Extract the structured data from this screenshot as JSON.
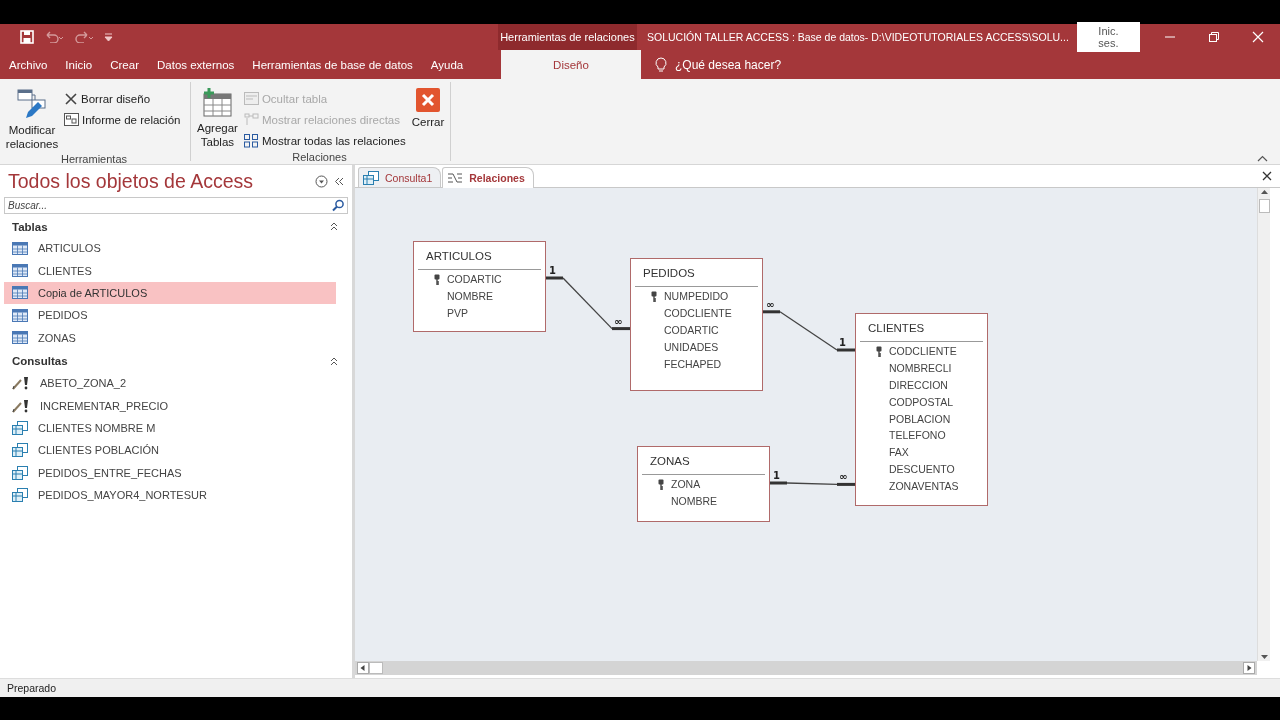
{
  "window": {
    "context_tab": "Herramientas de relaciones",
    "title": "SOLUCIÓN TALLER ACCESS : Base de datos- D:\\VIDEOTUTORIALES ACCESS\\SOLU...",
    "sign_in": "Inic. ses."
  },
  "ribbon_tabs": [
    {
      "label": "Archivo",
      "selected": false
    },
    {
      "label": "Inicio",
      "selected": false
    },
    {
      "label": "Crear",
      "selected": false
    },
    {
      "label": "Datos externos",
      "selected": false
    },
    {
      "label": "Herramientas de base de datos",
      "selected": false
    },
    {
      "label": "Ayuda",
      "selected": false
    },
    {
      "label": "Diseño",
      "selected": true
    }
  ],
  "tell_me": "¿Qué desea hacer?",
  "ribbon_groups": [
    {
      "label": "Herramientas",
      "buttons": [
        {
          "kind": "large",
          "label": "Modificar relaciones",
          "disabled": false
        },
        {
          "kind": "small",
          "label": "Borrar diseño",
          "disabled": false
        },
        {
          "kind": "small",
          "label": "Informe de relación",
          "disabled": false
        }
      ]
    },
    {
      "label": "Relaciones",
      "buttons": [
        {
          "kind": "large",
          "label": "Agregar Tablas",
          "disabled": false
        },
        {
          "kind": "small",
          "label": "Ocultar tabla",
          "disabled": true
        },
        {
          "kind": "small",
          "label": "Mostrar relaciones directas",
          "disabled": true
        },
        {
          "kind": "small",
          "label": "Mostrar todas las relaciones",
          "disabled": false
        },
        {
          "kind": "large",
          "label": "Cerrar",
          "disabled": false
        }
      ]
    }
  ],
  "nav_pane": {
    "title": "Todos los objetos de Access",
    "search": {
      "placeholder": "Buscar..."
    },
    "groups": [
      {
        "label": "Tablas",
        "expanded": true,
        "items": [
          {
            "kind": "table",
            "label": "ARTICULOS",
            "selected": false
          },
          {
            "kind": "table",
            "label": "CLIENTES",
            "selected": false
          },
          {
            "kind": "table",
            "label": "Copia de ARTICULOS",
            "selected": true
          },
          {
            "kind": "table",
            "label": "PEDIDOS",
            "selected": false
          },
          {
            "kind": "table",
            "label": "ZONAS",
            "selected": false
          }
        ]
      },
      {
        "label": "Consultas",
        "expanded": true,
        "items": [
          {
            "kind": "update",
            "label": "ABETO_ZONA_2",
            "selected": false
          },
          {
            "kind": "update",
            "label": "INCREMENTAR_PRECIO",
            "selected": false
          },
          {
            "kind": "select",
            "label": "CLIENTES NOMBRE M",
            "selected": false
          },
          {
            "kind": "select",
            "label": "CLIENTES POBLACIÓN",
            "selected": false
          },
          {
            "kind": "select",
            "label": "PEDIDOS_ENTRE_FECHAS",
            "selected": false
          },
          {
            "kind": "select",
            "label": "PEDIDOS_MAYOR4_NORTESUR",
            "selected": false
          }
        ]
      }
    ]
  },
  "document_tabs": [
    {
      "kind": "query",
      "label": "Consulta1",
      "selected": false
    },
    {
      "kind": "relations",
      "label": "Relaciones",
      "selected": true
    }
  ],
  "relationships": {
    "tables": [
      {
        "name": "ARTICULOS",
        "fields": [
          {
            "name": "CODARTIC",
            "key": true
          },
          {
            "name": "NOMBRE",
            "key": false
          },
          {
            "name": "PVP",
            "key": false
          }
        ]
      },
      {
        "name": "PEDIDOS",
        "fields": [
          {
            "name": "NUMPEDIDO",
            "key": true
          },
          {
            "name": "CODCLIENTE",
            "key": false
          },
          {
            "name": "CODARTIC",
            "key": false
          },
          {
            "name": "UNIDADES",
            "key": false
          },
          {
            "name": "FECHAPED",
            "key": false
          }
        ]
      },
      {
        "name": "CLIENTES",
        "fields": [
          {
            "name": "CODCLIENTE",
            "key": true
          },
          {
            "name": "NOMBRECLI",
            "key": false
          },
          {
            "name": "DIRECCION",
            "key": false
          },
          {
            "name": "CODPOSTAL",
            "key": false
          },
          {
            "name": "POBLACION",
            "key": false
          },
          {
            "name": "TELEFONO",
            "key": false
          },
          {
            "name": "FAX",
            "key": false
          },
          {
            "name": "DESCUENTO",
            "key": false
          },
          {
            "name": "ZONAVENTAS",
            "key": false
          }
        ]
      },
      {
        "name": "ZONAS",
        "fields": [
          {
            "name": "ZONA",
            "key": true
          },
          {
            "name": "NOMBRE",
            "key": false
          }
        ]
      }
    ],
    "links": [
      {
        "from_label": "1",
        "to_label": "∞"
      },
      {
        "from_label": "∞",
        "to_label": "1"
      },
      {
        "from_label": "1",
        "to_label": "∞"
      }
    ]
  },
  "status_bar": "Preparado"
}
